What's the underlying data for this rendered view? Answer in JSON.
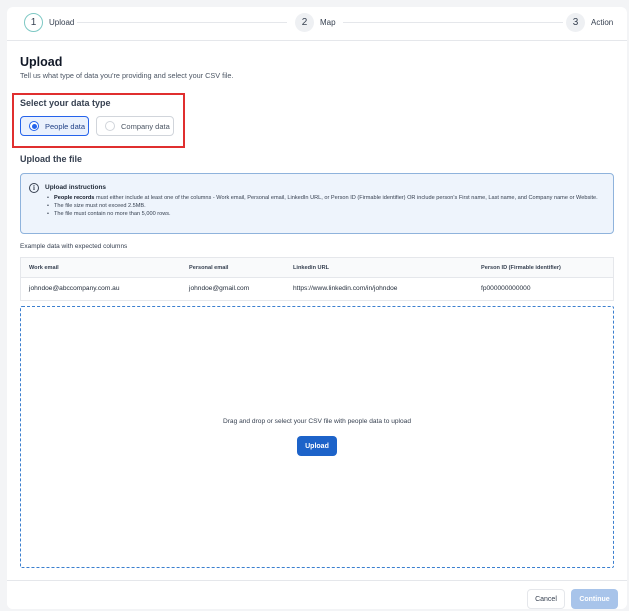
{
  "stepper": {
    "steps": [
      {
        "number": "1",
        "label": "Upload"
      },
      {
        "number": "2",
        "label": "Map"
      },
      {
        "number": "3",
        "label": "Action"
      }
    ]
  },
  "page": {
    "title": "Upload",
    "subtitle": "Tell us what type of data you're providing and select your CSV file."
  },
  "data_type": {
    "title": "Select your data type",
    "options": [
      {
        "label": "People data",
        "selected": true
      },
      {
        "label": "Company data",
        "selected": false
      }
    ]
  },
  "upload": {
    "title": "Upload the file",
    "instructions": {
      "title": "Upload instructions",
      "item1_bold": "People records",
      "item1_rest": " must either include at least one of the columns - Work email, Personal email, LinkedIn URL, or Person ID (Firmable identifier) OR include person's First name, Last name, and Company name or Website.",
      "item2": "The file size must not exceed 2.5MB.",
      "item3": "The file must contain no more than 5,000 rows."
    },
    "example_label": "Example data with expected columns",
    "table": {
      "headers": [
        "Work email",
        "Personal email",
        "Linkedin URL",
        "Person ID (Firmable identifier)"
      ],
      "row": [
        "johndoe@abccompany.com.au",
        "johndoe@gmail.com",
        "https://www.linkedin.com/in/johndoe",
        "fp000000000000"
      ]
    },
    "dropzone_text": "Drag and drop or select your CSV file with people data to upload",
    "upload_button": "Upload"
  },
  "footer": {
    "cancel": "Cancel",
    "continue": "Continue"
  }
}
